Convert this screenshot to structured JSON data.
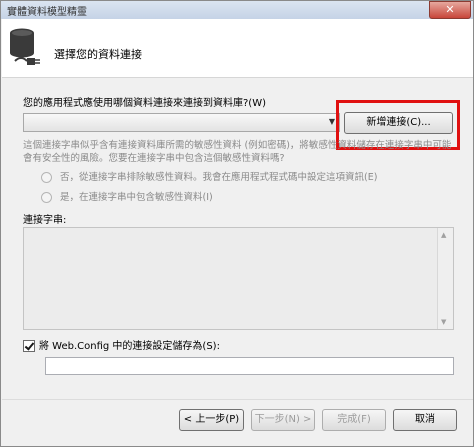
{
  "window": {
    "title": "實體資料模型精靈",
    "close_label": "✕"
  },
  "header": {
    "title": "選擇您的資料連接"
  },
  "question": "您的應用程式應使用哪個資料連接來連接到資料庫?(W)",
  "connection_combo": {
    "selected": ""
  },
  "new_connection_button": "新增連接(C)...",
  "sensitive_text": "這個連接字串似乎含有連接資料庫所需的敏感性資料 (例如密碼)，將敏感性資料儲存在連接字串中可能會有安全性的風險。您要在連接字串中包含這個敏感性資料嗎?",
  "radio_no": "否，從連接字串排除敏感性資料。我會在應用程式程式碼中設定這項資訊(E)",
  "radio_yes": "是，在連接字串中包含敏感性資料(I)",
  "connection_string_label": "連接字串:",
  "save_config_label": "將 Web.Config 中的連接設定儲存為(S):",
  "save_config_value": "",
  "buttons": {
    "previous": "< 上一步(P)",
    "next": "下一步(N) >",
    "finish": "完成(F)",
    "cancel": "取消"
  },
  "colors": {
    "highlight": "#e01010"
  }
}
